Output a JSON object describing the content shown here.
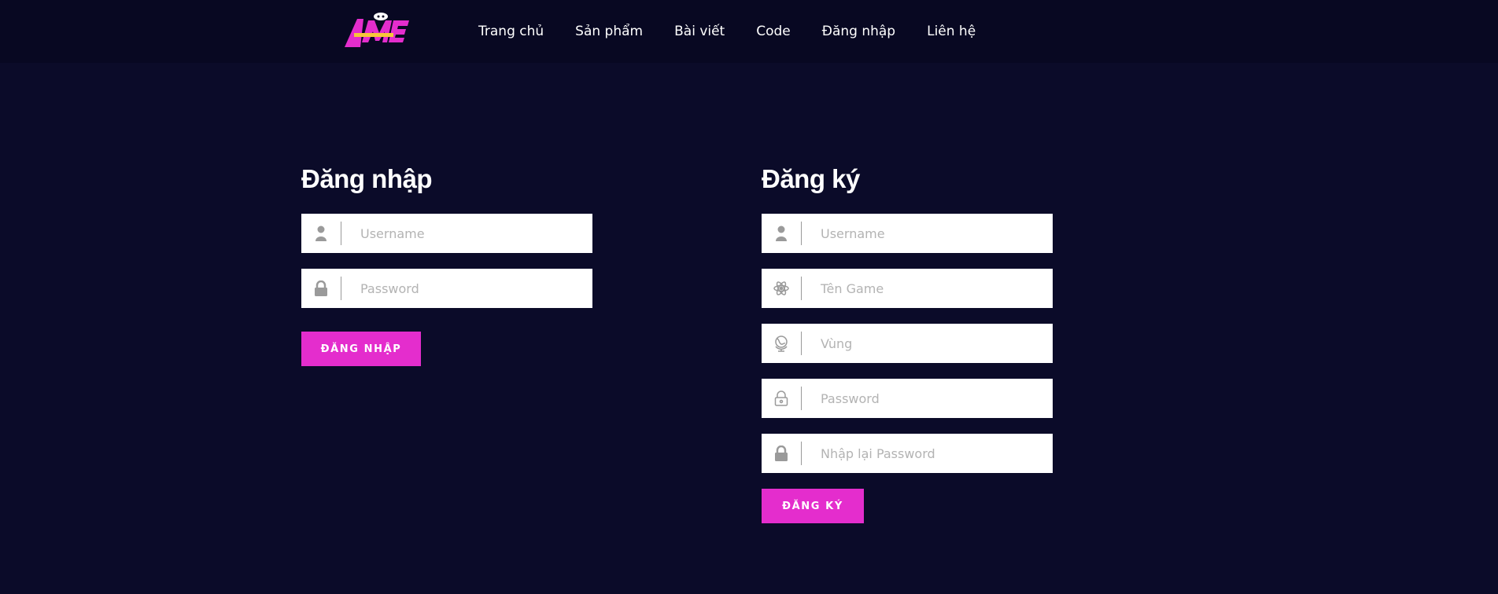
{
  "brand": {
    "logo_text": "AMME",
    "colors": {
      "accent": "#e42dcd",
      "bg": "#0b0b29",
      "header_bg": "#080822"
    }
  },
  "nav": {
    "items": [
      {
        "label": "Trang chủ"
      },
      {
        "label": "Sản phẩm"
      },
      {
        "label": "Bài viết"
      },
      {
        "label": "Code"
      },
      {
        "label": "Đăng nhập"
      },
      {
        "label": "Liên hệ"
      }
    ]
  },
  "login": {
    "title": "Đăng nhập",
    "fields": [
      {
        "icon": "user-icon",
        "placeholder": "Username",
        "value": ""
      },
      {
        "icon": "lock-icon",
        "placeholder": "Password",
        "value": ""
      }
    ],
    "button_label": "ĐĂNG NHẬP"
  },
  "register": {
    "title": "Đăng ký",
    "fields": [
      {
        "icon": "user-icon",
        "placeholder": "Username",
        "value": ""
      },
      {
        "icon": "atom-icon",
        "placeholder": "Tên Game",
        "value": ""
      },
      {
        "icon": "globe-icon",
        "placeholder": "Vùng",
        "value": ""
      },
      {
        "icon": "lock-outline-icon",
        "placeholder": "Password",
        "value": ""
      },
      {
        "icon": "lock-icon",
        "placeholder": "Nhập lại Password",
        "value": ""
      }
    ],
    "button_label": "ĐĂNG KÝ"
  }
}
